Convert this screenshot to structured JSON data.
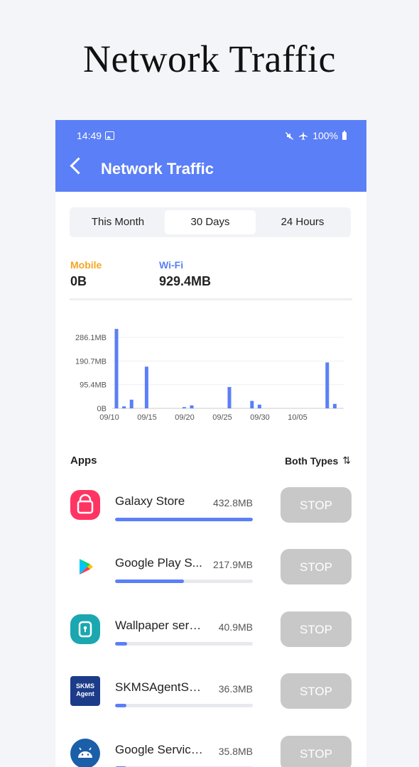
{
  "promo": {
    "title": "Network Traffic"
  },
  "status_bar": {
    "time": "14:49",
    "battery": "100%"
  },
  "header": {
    "title": "Network Traffic"
  },
  "tabs": [
    {
      "label": "This Month",
      "active": false
    },
    {
      "label": "30 Days",
      "active": true
    },
    {
      "label": "24 Hours",
      "active": false
    }
  ],
  "summary": {
    "mobile": {
      "label": "Mobile",
      "value": "0B"
    },
    "wifi": {
      "label": "Wi-Fi",
      "value": "929.4MB"
    }
  },
  "colors": {
    "accent": "#5b7ff6",
    "mobile": "#f5a623",
    "stop_disabled": "#c8c8c8"
  },
  "chart_data": {
    "type": "bar",
    "ytick_labels": [
      "0B",
      "95.4MB",
      "190.7MB",
      "286.1MB"
    ],
    "ytick_values": [
      0,
      95.4,
      190.7,
      286.1
    ],
    "ylim": [
      0,
      286.1
    ],
    "x_tick_labels": [
      "09/10",
      "09/15",
      "09/20",
      "09/25",
      "09/30",
      "10/05"
    ],
    "x_tick_index": [
      0,
      5,
      10,
      15,
      20,
      25
    ],
    "categories": [
      "09/10",
      "09/11",
      "09/12",
      "09/13",
      "09/14",
      "09/15",
      "09/16",
      "09/17",
      "09/18",
      "09/19",
      "09/20",
      "09/21",
      "09/22",
      "09/23",
      "09/24",
      "09/25",
      "09/26",
      "09/27",
      "09/28",
      "09/29",
      "09/30",
      "10/01",
      "10/02",
      "10/03",
      "10/04",
      "10/05",
      "10/06",
      "10/07",
      "10/08",
      "10/09"
    ],
    "series": [
      {
        "values": [
          320,
          8,
          35,
          0,
          168,
          0,
          0,
          0,
          0,
          5,
          12,
          0,
          0,
          0,
          0,
          86,
          0,
          0,
          30,
          15,
          0,
          0,
          0,
          0,
          0,
          0,
          0,
          0,
          185,
          18
        ]
      }
    ],
    "grid": true
  },
  "apps_section": {
    "label": "Apps",
    "filter_label": "Both Types"
  },
  "apps": [
    {
      "name": "Galaxy Store",
      "size": "432.8MB",
      "usage_fraction": 1.0,
      "icon": "galaxy-store-icon",
      "stop_label": "STOP"
    },
    {
      "name": "Google Play S...",
      "size": "217.9MB",
      "usage_fraction": 0.5,
      "icon": "google-play-icon",
      "stop_label": "STOP"
    },
    {
      "name": "Wallpaper servi...",
      "size": "40.9MB",
      "usage_fraction": 0.09,
      "icon": "wallpaper-service-icon",
      "stop_label": "STOP"
    },
    {
      "name": "SKMSAgentSer...",
      "size": "36.3MB",
      "usage_fraction": 0.08,
      "icon": "skms-agent-icon",
      "icon_text": "SKMS Agent",
      "stop_label": "STOP"
    },
    {
      "name": "Google Service...",
      "size": "35.8MB",
      "usage_fraction": 0.08,
      "icon": "android-icon",
      "stop_label": "STOP"
    }
  ]
}
